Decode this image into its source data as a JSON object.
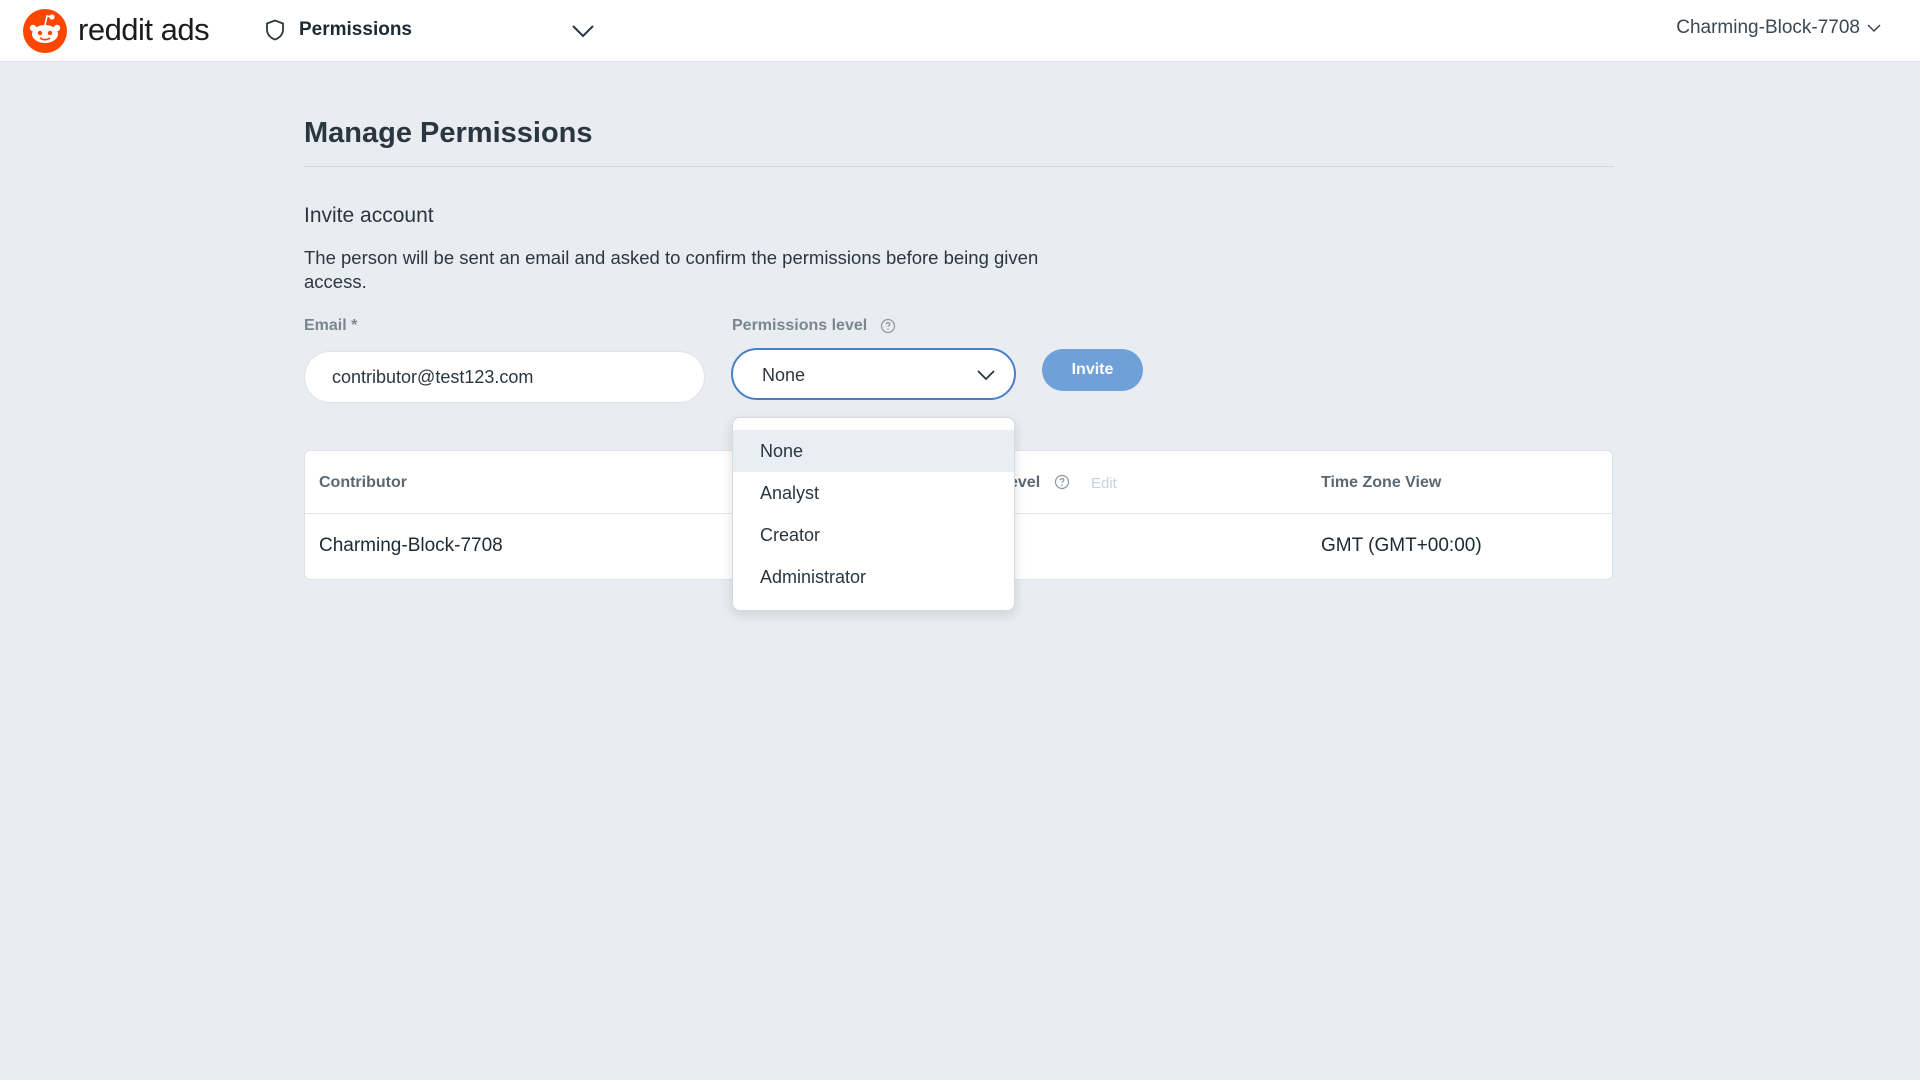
{
  "topbar": {
    "brand": "reddit ads",
    "nav_label": "Permissions",
    "account_name": "Charming-Block-7708",
    "brand_color": "#ff4500"
  },
  "page": {
    "title": "Manage Permissions",
    "section_title": "Invite account",
    "section_desc": "The person will be sent an email and asked to confirm the permissions before being given access."
  },
  "form": {
    "email_label": "Email *",
    "email_value": "contributor@test123.com",
    "permissions_label": "Permissions level",
    "permissions_value": "None",
    "invite_label": "Invite"
  },
  "dropdown": {
    "options": [
      "None",
      "Analyst",
      "Creator",
      "Administrator"
    ],
    "selected": "None"
  },
  "table": {
    "columns": {
      "contributor": "Contributor",
      "permissions_tail": "evel",
      "edit": "Edit",
      "time_zone": "Time Zone View"
    },
    "rows": [
      {
        "contributor": "Charming-Block-7708",
        "time_zone": "GMT (GMT+00:00)"
      }
    ]
  }
}
